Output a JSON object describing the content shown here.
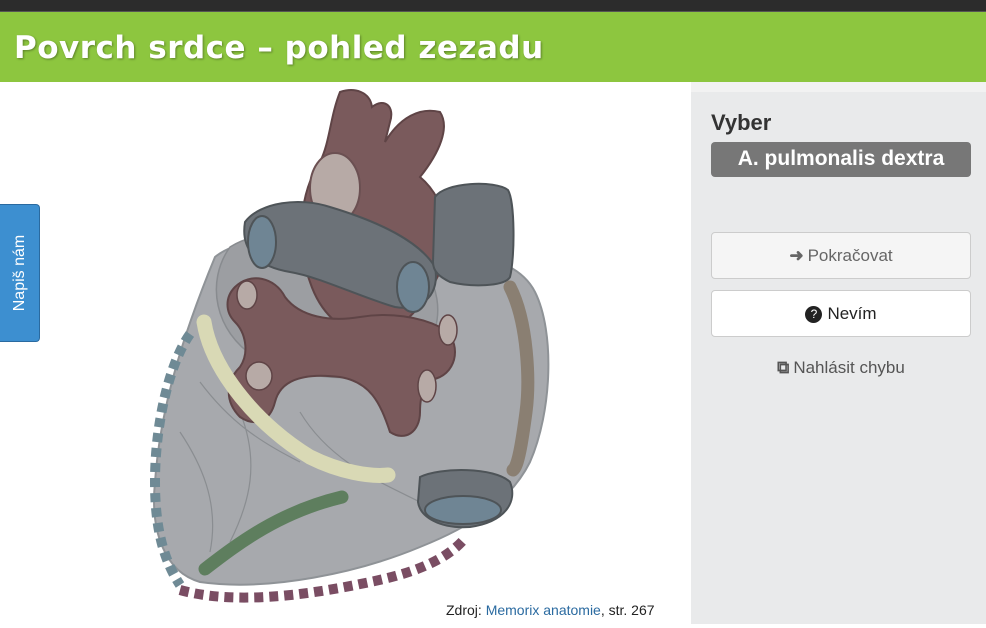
{
  "header": {
    "title": "Povrch srdce – pohled zezadu"
  },
  "feedback": {
    "label": "Napiš nám"
  },
  "source": {
    "prefix": "Zdroj: ",
    "link_text": "Memorix anatomie",
    "suffix": ", str. 267"
  },
  "panel": {
    "prompt_label": "Vyber",
    "term": "A. pulmonalis dextra",
    "continue_label": "Pokračovat",
    "dont_know_label": "Nevím",
    "report_label": "Nahlásit chybu"
  },
  "icons": {
    "continue": "arrow-right-icon",
    "dont_know": "question-circle-icon",
    "report": "external-link-icon"
  },
  "colors": {
    "header_bg": "#8dc63f",
    "feedback_tab": "#3d8fd0",
    "term_bg": "#777777",
    "highlight_yellow": "#d9d9b5",
    "highlight_green": "#5e7e5e",
    "highlight_brown": "#8a7f72",
    "highlight_blue_dashed": "#6f8a95",
    "highlight_purple_dashed": "#7a4d63"
  }
}
